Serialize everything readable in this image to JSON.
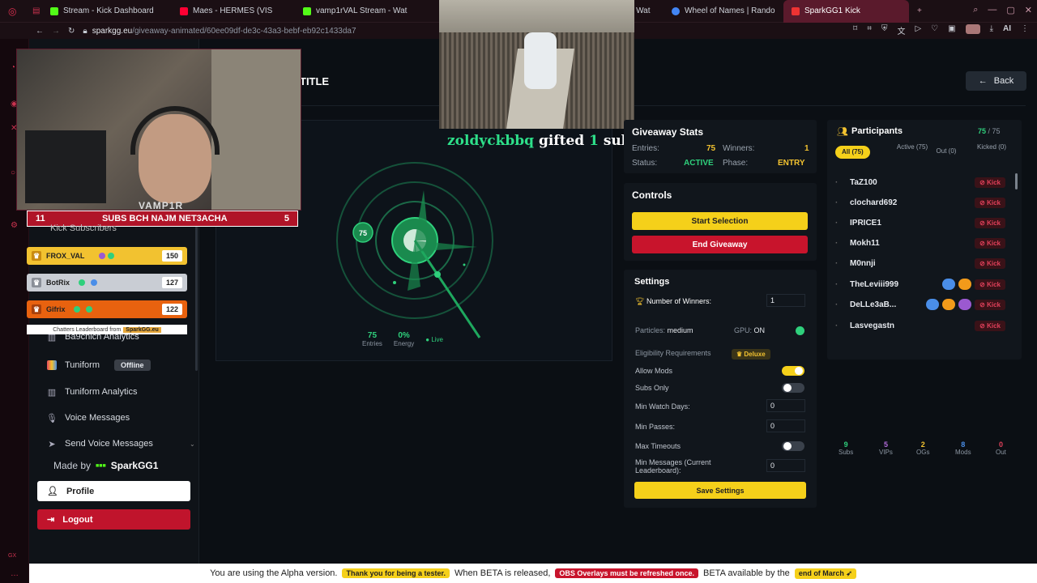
{
  "browser": {
    "tabs": [
      {
        "label": "Stream - Kick Dashboard",
        "color": "#53fc18"
      },
      {
        "label": "Maes - HERMES (VIS",
        "color": "#ff0033"
      },
      {
        "label": "vamp1rVAL Stream - Wat",
        "color": "#53fc18"
      },
      {
        "label": "- Wat",
        "color": "#53fc18"
      },
      {
        "label": "Wheel of Names | Rando",
        "color": "#4285f4"
      },
      {
        "label": "SparkGG1 Kick",
        "color": "#e33"
      }
    ],
    "url_host": "sparkgg.eu",
    "url_path": "/giveaway-animated/60ee09df-de3c-43a3-bebf-eb92c1433da7",
    "ai_label": "AI"
  },
  "overlay": {
    "webcam_name": "VAMP1R",
    "subs_bar": {
      "left": "11",
      "text": "SUBS BCH NAJM NET3ACHA",
      "right": "5"
    },
    "kick_subscribers": "Kick Subscribers",
    "leaderboard": [
      {
        "name": "FROX_VAL",
        "score": "150",
        "bg": "#f2c230"
      },
      {
        "name": "BotRix",
        "score": "127",
        "bg": "#c9cdd4"
      },
      {
        "name": "Gifrix",
        "score": "122",
        "bg": "#e8620f"
      }
    ],
    "leaderboard_footer": "Chatters Leaderboard from",
    "leaderboard_brand": "SparkGG.eu",
    "gifted_user": "zoldyckbbq",
    "gifted_mid": "gifted",
    "gifted_count": "1",
    "gifted_tail": "sub(s)!"
  },
  "sidebar": {
    "items": [
      {
        "label": "Ba9chich Analytics",
        "icon": "bar-chart-icon"
      },
      {
        "label": "Tuniform",
        "icon": "tuniform-icon",
        "badge": "Offline"
      },
      {
        "label": "Tuniform Analytics",
        "icon": "bar-chart-icon"
      },
      {
        "label": "Voice Messages",
        "icon": "mic-icon"
      },
      {
        "label": "Send Voice Messages",
        "icon": "send-icon"
      }
    ],
    "made_by": "Made by",
    "made_by_brand": "SparkGG1",
    "profile": "Profile",
    "logout": "Logout"
  },
  "main": {
    "title": "TITLE",
    "back": "Back",
    "radar": {
      "marker": "75",
      "entries_value": "75",
      "entries_label": "Entries",
      "energy_value": "0%",
      "energy_label": "Energy",
      "live": "Live"
    }
  },
  "stats": {
    "title": "Giveaway Stats",
    "entries_label": "Entries:",
    "entries_value": "75",
    "winners_label": "Winners:",
    "winners_value": "1",
    "status_label": "Status:",
    "status_value": "ACTIVE",
    "phase_label": "Phase:",
    "phase_value": "ENTRY"
  },
  "controls": {
    "title": "Controls",
    "start": "Start Selection",
    "end": "End Giveaway"
  },
  "settings": {
    "title": "Settings",
    "num_winners_label": "Number of Winners:",
    "num_winners_value": "1",
    "particles_label": "Particles:",
    "particles_value": "medium",
    "gpu_label": "GPU:",
    "gpu_value": "ON",
    "eligibility_label": "Eligibility Requirements",
    "deluxe": "Deluxe",
    "allow_mods": "Allow Mods",
    "subs_only": "Subs Only",
    "min_watch_days": "Min Watch Days:",
    "min_watch_days_value": "0",
    "min_passes": "Min Passes:",
    "min_passes_value": "0",
    "max_timeouts": "Max Timeouts",
    "min_messages": "Min Messages (Current Leaderboard):",
    "min_messages_value": "0",
    "save": "Save Settings"
  },
  "participants": {
    "title": "Participants",
    "count": "75",
    "total": "/ 75",
    "tabs": {
      "all": "All (75)",
      "active": "Active (75)",
      "out": "Out (0)",
      "kicked": "Kicked (0)"
    },
    "kick_label": "Kick",
    "list": [
      {
        "name": "TaZ100"
      },
      {
        "name": "clochard692"
      },
      {
        "name": "IPRICE1"
      },
      {
        "name": "Mokh11"
      },
      {
        "name": "M0nnji"
      },
      {
        "name": "TheLeviii999"
      },
      {
        "name": "DeLLe3aB..."
      },
      {
        "name": "Lasvegastn"
      }
    ],
    "footer": [
      {
        "n": "9",
        "label": "Subs",
        "color": "#2fd07c"
      },
      {
        "n": "5",
        "label": "VIPs",
        "color": "#b06ad8"
      },
      {
        "n": "2",
        "label": "OGs",
        "color": "#f2c230"
      },
      {
        "n": "8",
        "label": "Mods",
        "color": "#4a8ee8"
      },
      {
        "n": "0",
        "label": "Out",
        "color": "#e0405a"
      }
    ]
  },
  "banner": {
    "t1": "You are using the Alpha version.",
    "h1": "Thank you for being a tester.",
    "t2": "When BETA is released,",
    "h2": "OBS Overlays must be refreshed once.",
    "t3": "BETA available by the",
    "h3": "end of March"
  }
}
